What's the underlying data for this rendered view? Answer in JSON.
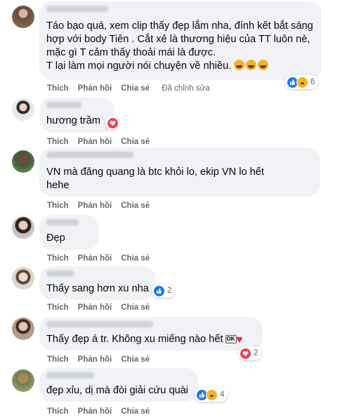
{
  "actions": {
    "like": "Thích",
    "reply": "Phản hồi",
    "share": "Chia sẻ",
    "edited": "Đã chỉnh sửa"
  },
  "colors": {
    "bubble": "#f0f2f5",
    "like_blue": "#1877f2",
    "haha_yellow": "#f7b125",
    "love_red": "#f33e58",
    "meta_gray": "#65676b"
  },
  "comments": [
    {
      "text": "Táo bạo quá, xem clip thấy đẹp lắm nha, đính kết bắt sáng hợp với body Tiên . Cắt xẻ là thương hiệu của TT luôn nè, mặc gì T cảm thấy thoải mái là được.\nT lại làm mọi người nói chuyện về nhiều.",
      "reactions": [
        "like-icon",
        "haha-icon"
      ],
      "count": "6"
    },
    {
      "text": "hương trầm",
      "reactions": [
        "love-icon"
      ],
      "count": ""
    },
    {
      "text": "VN mà đăng quang là btc khỏi lo, ekip VN lo hết\nhehe",
      "reactions": [],
      "count": ""
    },
    {
      "text": "Đẹp",
      "reactions": [],
      "count": ""
    },
    {
      "text": "Thấy sang hơn xu nha",
      "reactions": [
        "like-icon"
      ],
      "count": "2"
    },
    {
      "text": "Thấy đẹp á tr. Không xu miếng nào hết",
      "reactions": [
        "love-icon"
      ],
      "count": "2"
    },
    {
      "text": "đẹp xỉu, dị mà đòi giải cứu quài",
      "reactions": [
        "like-icon",
        "haha-icon"
      ],
      "count": "4"
    }
  ]
}
